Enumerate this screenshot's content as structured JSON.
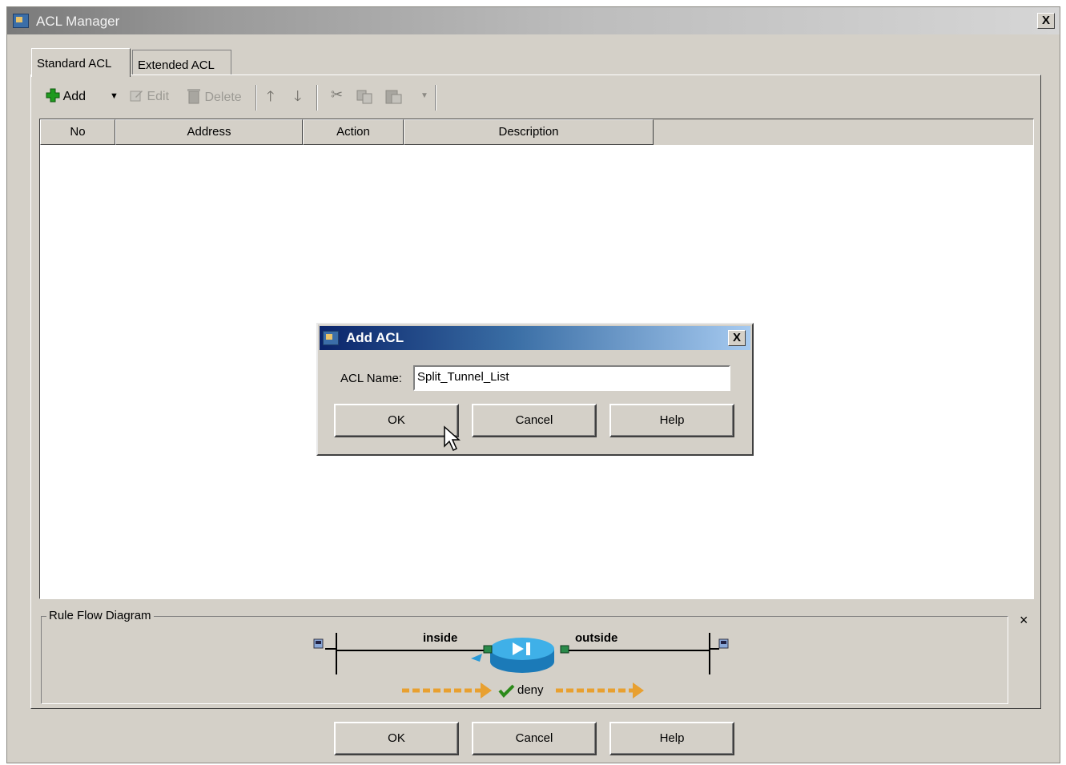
{
  "window": {
    "title": "ACL Manager",
    "close": "X"
  },
  "tabs": [
    "Standard ACL",
    "Extended ACL"
  ],
  "toolbar": {
    "add": "Add",
    "edit": "Edit",
    "delete": "Delete"
  },
  "table": {
    "headers": [
      "No",
      "Address",
      "Action",
      "Description"
    ]
  },
  "rule_flow": {
    "title": "Rule Flow Diagram",
    "inside": "inside",
    "outside": "outside",
    "action": "deny",
    "close": "×"
  },
  "dialog": {
    "title": "Add ACL",
    "name_label": "ACL Name:",
    "name_value": "Split_Tunnel_List",
    "ok": "OK",
    "cancel": "Cancel",
    "help": "Help",
    "close": "X"
  },
  "footer": {
    "ok": "OK",
    "cancel": "Cancel",
    "help": "Help"
  },
  "colors": {
    "accent_blue": "#0a246a",
    "flow_arrow": "#e8a030",
    "router": "#2a9ad8",
    "check": "#2c8a1a"
  }
}
